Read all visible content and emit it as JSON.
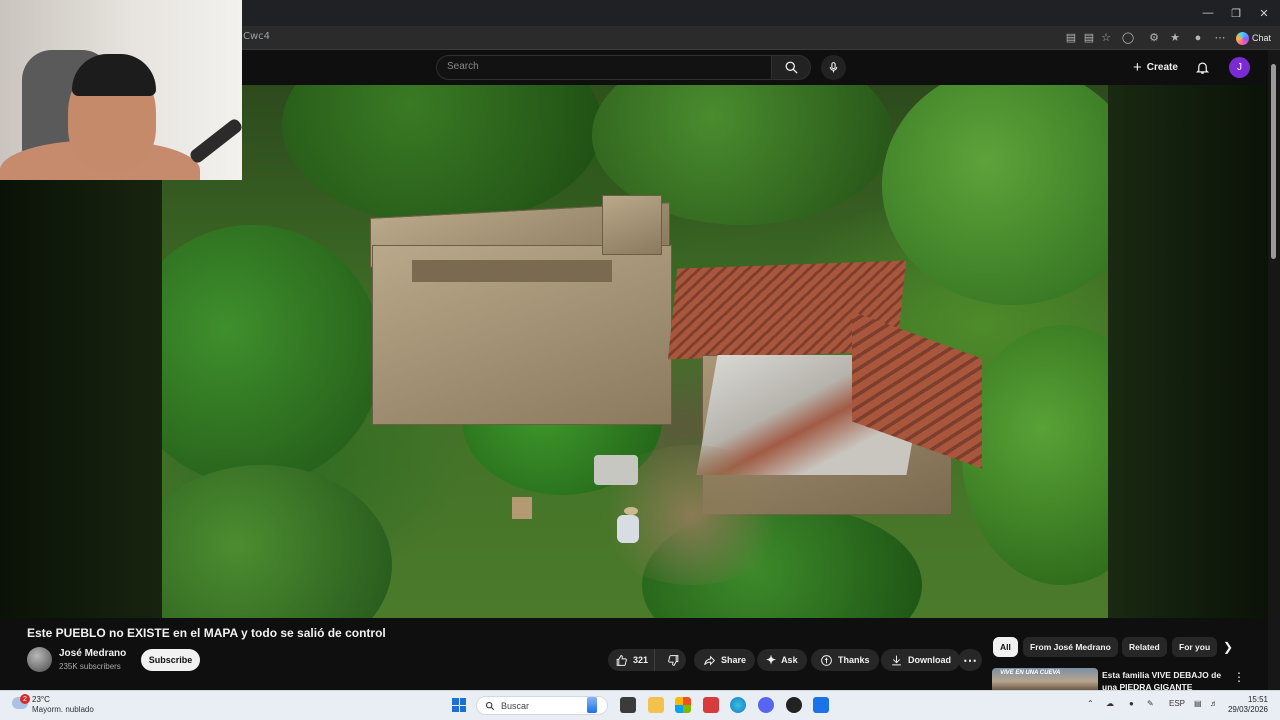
{
  "browser": {
    "url_fragment": "Cwc4",
    "chat_label": "Chat",
    "window_controls": [
      "minimize",
      "restore",
      "close"
    ]
  },
  "youtube": {
    "search_placeholder": "Search",
    "create_label": "Create",
    "avatar_initial": "J"
  },
  "video": {
    "title": "Este PUEBLO no EXISTE en el MAPA y todo se salió de control",
    "channel_name": "José Medrano",
    "channel_subs": "235K subscribers",
    "subscribe_label": "Subscribe",
    "like_count": "321",
    "actions": {
      "share": "Share",
      "ask": "Ask",
      "thanks": "Thanks",
      "download": "Download"
    }
  },
  "chips": [
    "All",
    "From José Medrano",
    "Related",
    "For you"
  ],
  "recommended": {
    "title": "Esta familia VIVE DEBAJO de una PIEDRA GIGANTE",
    "thumb_text": "VIVE EN UNA CUEVA"
  },
  "taskbar": {
    "weather_badge": "2",
    "temperature": "23°C",
    "weather_desc": "Mayorm. nublado",
    "search_label": "Buscar",
    "language": "ESP",
    "time": "15:51",
    "date": "29/03/2026"
  }
}
